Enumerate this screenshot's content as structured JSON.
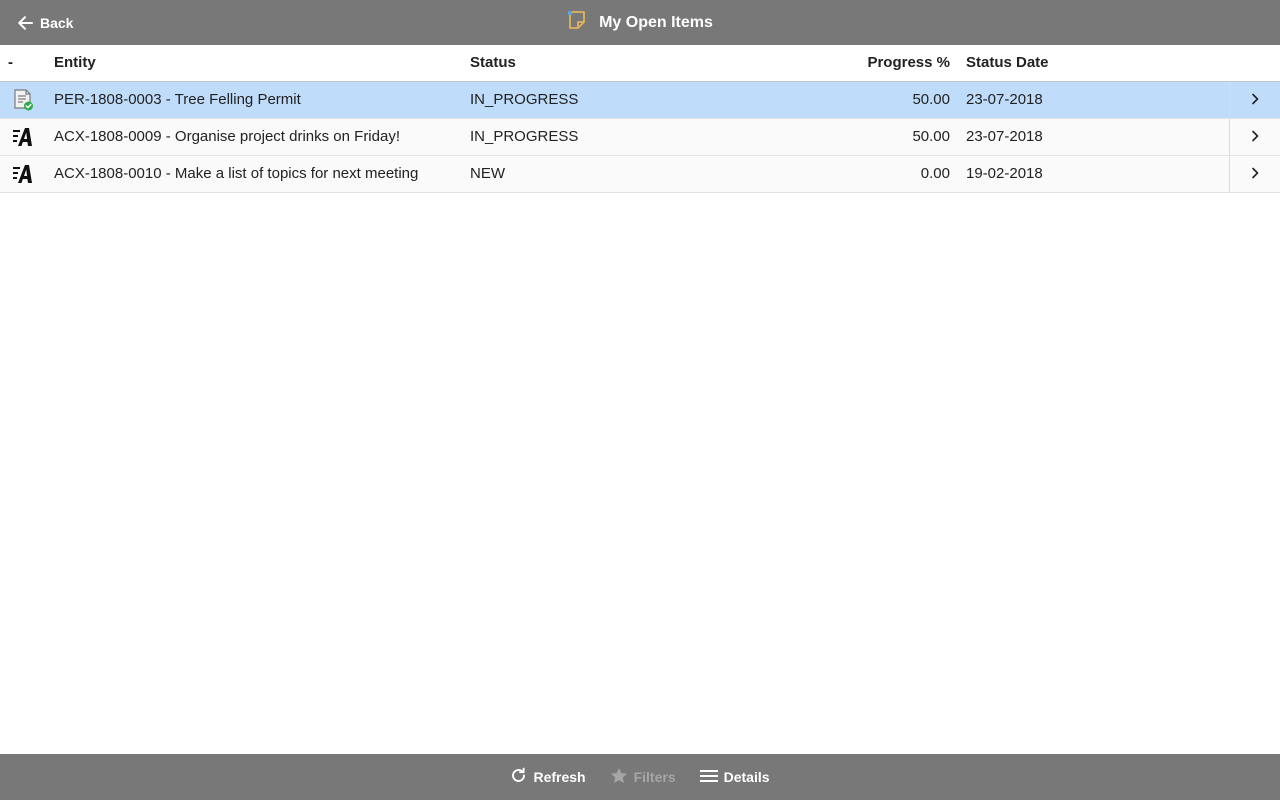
{
  "header": {
    "back_label": "Back",
    "title": "My Open Items",
    "title_icon": "sticky-note-icon",
    "bar_color": "#787878"
  },
  "grid": {
    "columns": {
      "icon": "-",
      "entity": "Entity",
      "status": "Status",
      "progress": "Progress %",
      "status_date": "Status Date"
    },
    "rows": [
      {
        "icon": "permit-document-icon",
        "entity": "PER-1808-0003 - Tree Felling Permit",
        "status": "IN_PROGRESS",
        "progress": "50.00",
        "status_date": "23-07-2018",
        "selected": true
      },
      {
        "icon": "action-icon",
        "entity": "ACX-1808-0009 - Organise project drinks on Friday!",
        "status": "IN_PROGRESS",
        "progress": "50.00",
        "status_date": "23-07-2018",
        "selected": false
      },
      {
        "icon": "action-icon",
        "entity": "ACX-1808-0010 - Make a list of topics for next meeting",
        "status": "NEW",
        "progress": "0.00",
        "status_date": "19-02-2018",
        "selected": false
      }
    ],
    "selected_color": "#bfdcfa"
  },
  "footer": {
    "refresh_label": "Refresh",
    "filters_label": "Filters",
    "details_label": "Details"
  }
}
